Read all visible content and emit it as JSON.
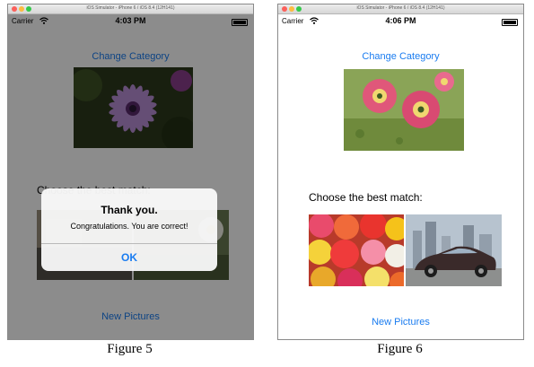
{
  "colors": {
    "link": "#1a7cf0",
    "alert_button": "#1a7cf0"
  },
  "figure5": {
    "simulator_title": "iOS Simulator - iPhone 6 / iOS 8.4 (12H141)",
    "carrier": "Carrier",
    "time": "4:03 PM",
    "change_category": "Change Category",
    "prompt": "Choose the best match:",
    "new_pictures": "New Pictures",
    "alert": {
      "title": "Thank you.",
      "message": "Congratulations. You are correct!",
      "button": "OK"
    },
    "caption": "Figure 5"
  },
  "figure6": {
    "simulator_title": "iOS Simulator - iPhone 6 / iOS 8.4 (12H141)",
    "carrier": "Carrier",
    "time": "4:06 PM",
    "change_category": "Change Category",
    "prompt": "Choose the best match:",
    "new_pictures": "New Pictures",
    "caption": "Figure 6"
  },
  "icons": {
    "wifi": "wifi-icon",
    "battery": "battery-icon",
    "close": "close-icon",
    "minimize": "minimize-icon",
    "zoom": "zoom-icon"
  }
}
